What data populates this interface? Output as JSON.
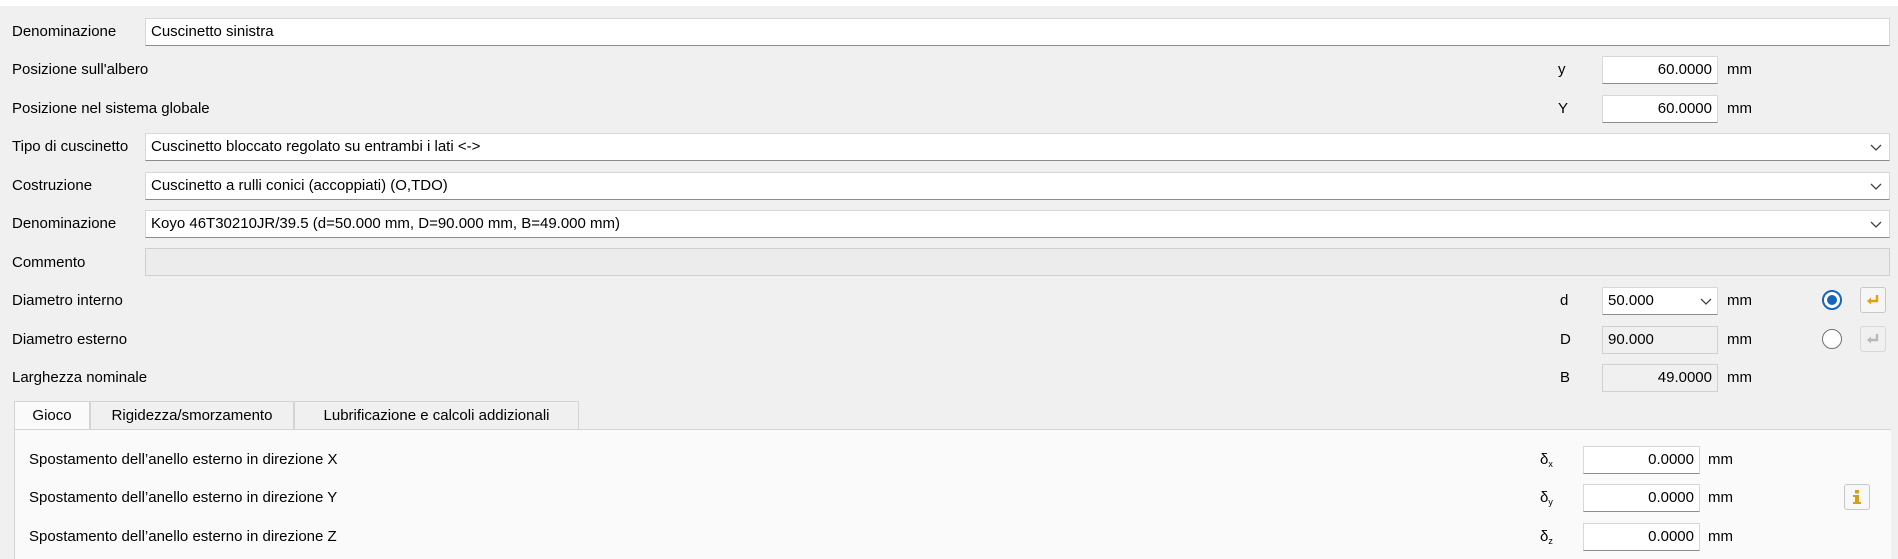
{
  "rows": {
    "name1": {
      "label": "Denominazione",
      "value": "Cuscinetto sinistra"
    },
    "pos_shaft": {
      "label": "Posizione sull'albero",
      "symbol": "y",
      "value": "60.0000",
      "unit": "mm"
    },
    "pos_global": {
      "label": "Posizione nel sistema globale",
      "symbol": "Y",
      "value": "60.0000",
      "unit": "mm"
    },
    "bearing_type": {
      "label": "Tipo di cuscinetto",
      "value": "Cuscinetto bloccato regolato su entrambi i lati <->"
    },
    "construction": {
      "label": "Costruzione",
      "value": "Cuscinetto a rulli conici (accoppiati) (O,TDO)"
    },
    "name2": {
      "label": "Denominazione",
      "value": "Koyo 46T30210JR/39.5 (d=50.000 mm, D=90.000 mm, B=49.000 mm)"
    },
    "comment": {
      "label": "Commento",
      "value": ""
    },
    "inner_d": {
      "label": "Diametro interno",
      "symbol": "d",
      "value": "50.000",
      "unit": "mm"
    },
    "outer_d": {
      "label": "Diametro esterno",
      "symbol": "D",
      "value": "90.000",
      "unit": "mm"
    },
    "width": {
      "label": "Larghezza nominale",
      "symbol": "B",
      "value": "49.0000",
      "unit": "mm"
    }
  },
  "tabs": [
    {
      "label": "Gioco",
      "active": true
    },
    {
      "label": "Rigidezza/smorzamento",
      "active": false
    },
    {
      "label": "Lubrificazione e calcoli addizionali",
      "active": false
    }
  ],
  "gioco": {
    "x": {
      "label": "Spostamento dell’anello esterno in direzione X",
      "symbol": "δ",
      "sub": "x",
      "value": "0.0000",
      "unit": "mm"
    },
    "y": {
      "label": "Spostamento dell’anello esterno in direzione Y",
      "symbol": "δ",
      "sub": "y",
      "value": "0.0000",
      "unit": "mm"
    },
    "z": {
      "label": "Spostamento dell’anello esterno in direzione Z",
      "symbol": "δ",
      "sub": "z",
      "value": "0.0000",
      "unit": "mm"
    }
  },
  "colors": {
    "radio_accent": "#1565c0",
    "arrow_active": "#e0a010",
    "info_icon": "#d4a017"
  },
  "icons": {
    "apply_active": "return-arrow-icon",
    "apply_inactive": "return-arrow-icon",
    "info": "info-icon"
  }
}
